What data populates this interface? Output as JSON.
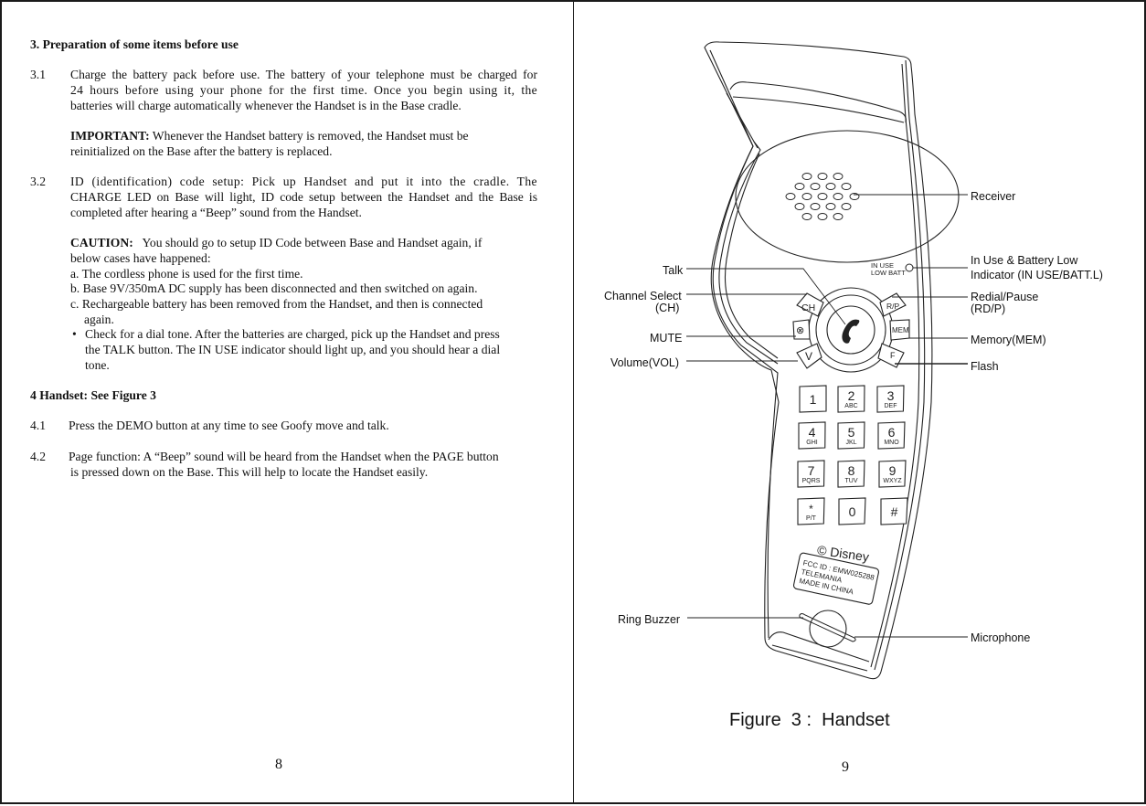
{
  "left_page": {
    "section3": {
      "heading": "3. Preparation of some items before use",
      "item_3_1": {
        "number": "3.1",
        "lines": [
          "Charge the battery pack before use. The battery of your telephone must be charged for",
          "24 hours before using your phone for the first time. Once you begin using it, the",
          "batteries will charge automatically whenever the Handset is in the Base cradle."
        ],
        "important_label": "IMPORTANT:",
        "important_lines": [
          "Whenever the Handset battery is removed, the Handset must be",
          "reinitialized on the Base after the battery is replaced."
        ]
      },
      "item_3_2": {
        "number": "3.2",
        "lines": [
          "ID (identification) code setup: Pick up Handset and put it into the cradle. The",
          "CHARGE LED on Base will light, ID code setup between the Handset and the Base is",
          "completed after hearing a “Beep” sound from the Handset."
        ],
        "caution_label": "CAUTION:",
        "caution_lines": [
          "You should go to setup ID Code between Base and Handset again, if",
          "below cases  have happened:"
        ],
        "cases": [
          "a. The cordless phone is used for the first time.",
          "b. Base 9V/350mA DC supply has been disconnected and then switched on again.",
          "c. Rechargeable battery has been removed from the Handset, and then is connected",
          "again."
        ],
        "bullet_symbol": "•",
        "bullet_lines": [
          "Check for a dial tone. After the batteries are charged, pick up the Handset and press",
          "the TALK button. The IN USE indicator should light up, and you should hear a dial",
          "tone."
        ]
      }
    },
    "section4": {
      "heading": "4 Handset: See Figure 3",
      "item_4_1": {
        "number": "4.1",
        "text": "Press the DEMO button at any time to see Goofy move and talk."
      },
      "item_4_2": {
        "number": "4.2",
        "lines": [
          "Page function: A “Beep” sound will be heard from the Handset when the PAGE button",
          "is pressed down on the Base. This will help to locate the Handset easily."
        ]
      }
    },
    "page_number": "8"
  },
  "right_page": {
    "figure": {
      "caption": "Figure  3 :  Handset",
      "labels_left": {
        "talk": "Talk",
        "channel_select": "Channel Select",
        "channel_select_abbr": "(CH)",
        "mute": "MUTE",
        "volume": "Volume(VOL)",
        "ring_buzzer": "Ring Buzzer"
      },
      "labels_right": {
        "receiver": "Receiver",
        "in_use_line1": "In Use & Battery Low",
        "in_use_line2": "Indicator (IN USE/BATT.L)",
        "redial_line1": "Redial/Pause",
        "redial_line2": "(RD/P)",
        "memory": "Memory(MEM)",
        "flash": "Flash",
        "microphone": "Microphone"
      },
      "handset": {
        "indicator_text_1": "IN USE",
        "indicator_text_2": "LOW BATT",
        "side_buttons": {
          "ch": "CH",
          "rp": "R/P",
          "mem": "MEM",
          "vol": "V",
          "flash": "F",
          "mute": "⊗"
        },
        "keypad": [
          {
            "digit": "1",
            "letters": ""
          },
          {
            "digit": "2",
            "letters": "ABC"
          },
          {
            "digit": "3",
            "letters": "DEF"
          },
          {
            "digit": "4",
            "letters": "GHI"
          },
          {
            "digit": "5",
            "letters": "JKL"
          },
          {
            "digit": "6",
            "letters": "MNO"
          },
          {
            "digit": "7",
            "letters": "PQRS"
          },
          {
            "digit": "8",
            "letters": "TUV"
          },
          {
            "digit": "9",
            "letters": "WXYZ"
          },
          {
            "digit": "*",
            "letters": "P/T"
          },
          {
            "digit": "0",
            "letters": ""
          },
          {
            "digit": "#",
            "letters": ""
          }
        ],
        "brand": "© Disney",
        "fcc_lines": [
          "FCC ID : EMW025288",
          "TELEMANIA",
          "MADE IN CHINA"
        ]
      }
    },
    "page_number": "9"
  }
}
